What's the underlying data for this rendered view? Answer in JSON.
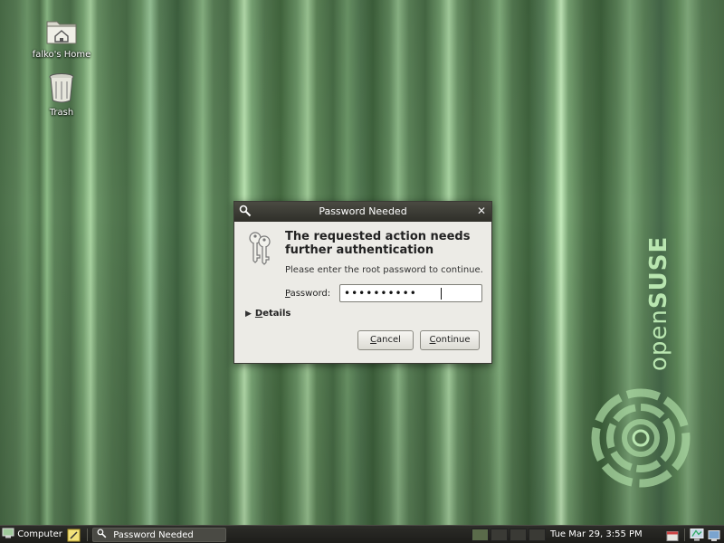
{
  "desktop": {
    "icons": [
      {
        "label": "falko's Home",
        "icon": "home-folder-icon"
      },
      {
        "label": "Trash",
        "icon": "trash-icon"
      }
    ],
    "brand": {
      "light": "open",
      "bold": "SUSE"
    }
  },
  "dialog": {
    "title": "Password Needed",
    "heading": "The requested action needs further authentication",
    "message": "Please enter the root password to continue.",
    "password_label_mnemonic": "P",
    "password_label_rest": "assword:",
    "password_value": "••••••••••",
    "details_mnemonic": "D",
    "details_rest": "etails",
    "cancel_mnemonic": "C",
    "cancel_rest": "ancel",
    "continue_mnemonic": "C",
    "continue_rest": "ontinue"
  },
  "taskbar": {
    "menu_label": "Computer",
    "window_label": "Password Needed",
    "clock": "Tue Mar 29,   3:55 PM",
    "workspaces": 4,
    "active_workspace": 1
  },
  "colors": {
    "desktop_green": "#5b7e58",
    "dialog_bg": "#ecebe6",
    "titlebar": "#2f2f29",
    "taskbar": "#1d1d1a",
    "brand_text": "#b9e6b0"
  }
}
